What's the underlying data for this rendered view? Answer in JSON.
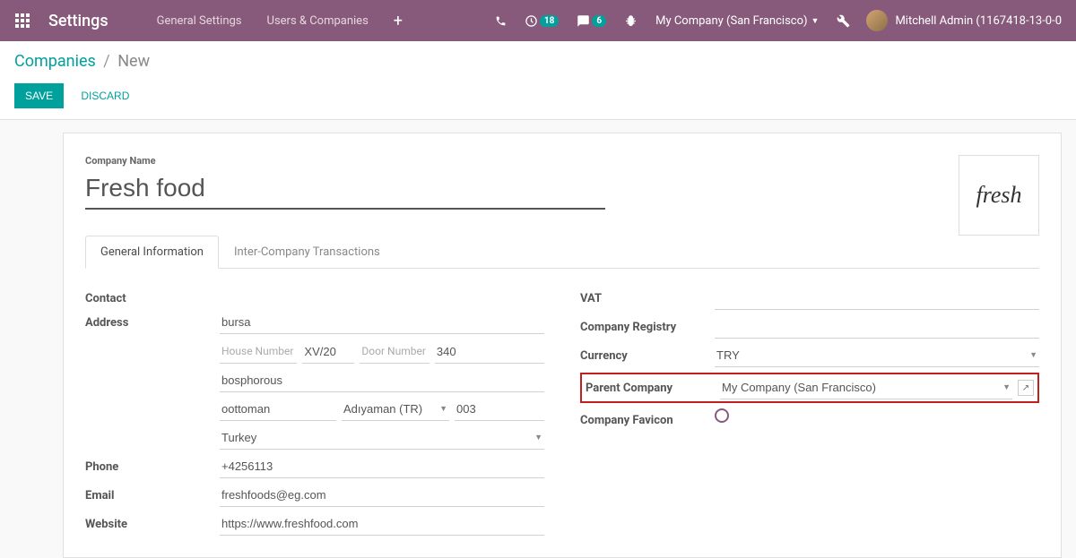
{
  "nav": {
    "brand": "Settings",
    "menu": [
      "General Settings",
      "Users & Companies"
    ],
    "badges": {
      "calendar": "18",
      "chat": "6"
    },
    "company": "My Company (San Francisco)",
    "user": "Mitchell Admin (1167418-13-0-0"
  },
  "breadcrumb": {
    "root": "Companies",
    "current": "New"
  },
  "actions": {
    "save": "SAVE",
    "discard": "DISCARD"
  },
  "form": {
    "company_name_label": "Company Name",
    "company_name": "Fresh food",
    "logo_text": "fresh",
    "tabs": [
      "General Information",
      "Inter-Company Transactions"
    ],
    "left": {
      "contact_label": "Contact",
      "address_label": "Address",
      "street": "bursa",
      "house_ph": "House Number",
      "house": "XV/20",
      "door_ph": "Door Number",
      "door": "340",
      "street2": "bosphorous",
      "city": "oottoman",
      "state": "Adıyaman (TR)",
      "zip": "003",
      "country": "Turkey",
      "phone_label": "Phone",
      "phone": "+4256113",
      "email_label": "Email",
      "email": "freshfoods@eg.com",
      "website_label": "Website",
      "website": "https://www.freshfood.com"
    },
    "right": {
      "vat_label": "VAT",
      "vat": "",
      "registry_label": "Company Registry",
      "registry": "",
      "currency_label": "Currency",
      "currency": "TRY",
      "parent_label": "Parent Company",
      "parent": "My Company (San Francisco)",
      "favicon_label": "Company Favicon"
    }
  }
}
